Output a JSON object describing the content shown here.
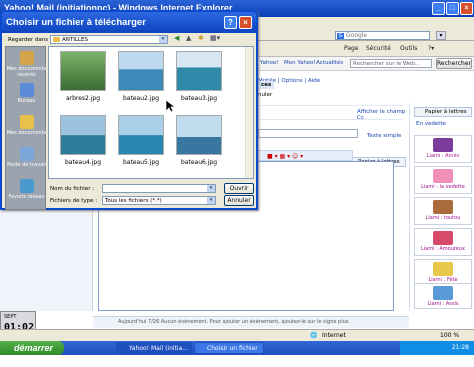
{
  "browser": {
    "title": "Yahoo! Mail (initiationpc) - Windows Internet Explorer",
    "search_placeholder": "Google",
    "cmdbar": {
      "page": "Page",
      "security": "Sécurité",
      "tools": "Outils",
      "help": "Aide"
    },
    "toolbar_links": [
      "Yahoo!",
      "Mon Yahoo!",
      "Actualités"
    ],
    "search_web_placeholder": "Rechercher sur le Web...",
    "search_button": "Rechercher",
    "tab_links": [
      "Mobile",
      "Options",
      "Aide"
    ],
    "tab_fragment": "ces",
    "send_fragment": "nuler"
  },
  "compose": {
    "show_cc": "Afficher le champ Cc",
    "plain_text": "Texte simple",
    "stationery_button": "Papier à lettres",
    "stationery_button2": "Papier à lettres",
    "featured_label": "En vedette",
    "status_line": "Aujourd'hui 7/26  Aucun événement. Pour ajouter un événement, ajoutez-le sur le signe plus."
  },
  "stationery": [
    {
      "label": "Liami : Anniv"
    },
    {
      "label": "Liami : la vedette"
    },
    {
      "label": "Liami : toutou"
    },
    {
      "label": "Liami : Amoureux"
    },
    {
      "label": "Liami : Fête"
    },
    {
      "label": "Liami : Assis"
    }
  ],
  "dialog": {
    "title": "Choisir un fichier à télécharger",
    "look_in_label": "Regarder dans :",
    "look_in_value": "ANTILLES",
    "places": [
      "Mes documents récents",
      "Bureau",
      "Mes documents",
      "Poste de travail",
      "Favoris réseau"
    ],
    "files": [
      {
        "name": "arbres2.jpg"
      },
      {
        "name": "bateau2.jpg"
      },
      {
        "name": "bateau3.jpg"
      },
      {
        "name": "bateau4.jpg"
      },
      {
        "name": "bateau5.jpg"
      },
      {
        "name": "bateau6.jpg"
      }
    ],
    "filename_label": "Nom du fichier :",
    "filename_value": "",
    "filetype_label": "Fichiers de type :",
    "filetype_value": "Tous les fichiers (*.*)",
    "open_button": "Ouvrir",
    "cancel_button": "Annuler"
  },
  "statusbar": {
    "zone": "Internet",
    "zoom": "100 %"
  },
  "taskbar": {
    "start": "démarrer",
    "tasks": [
      "Yahoo! Mail (initia...",
      "Choisir un fichier à..."
    ],
    "clock": "21:28"
  },
  "desktop_clock": {
    "time": "01:02",
    "date": "SEPT"
  }
}
